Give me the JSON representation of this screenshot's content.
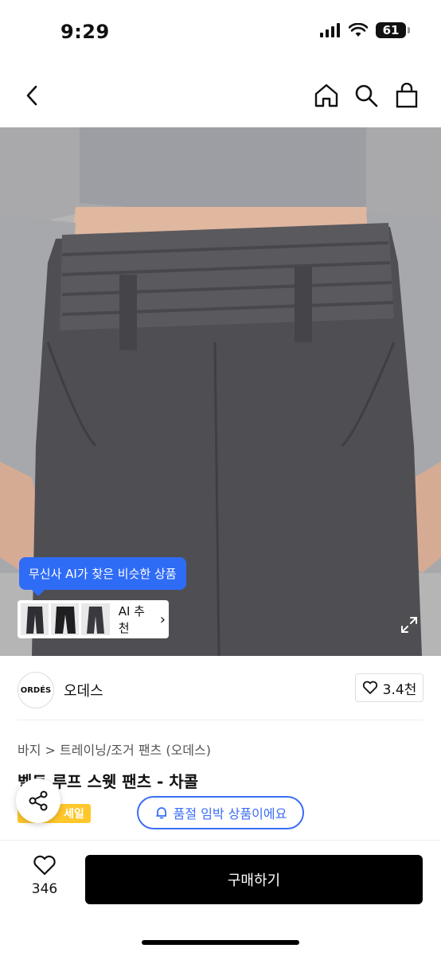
{
  "status_bar": {
    "time": "9:29",
    "battery": "61"
  },
  "nav": {
    "back_icon": "chevron-left-icon",
    "home_icon": "home-icon",
    "search_icon": "search-icon",
    "cart_icon": "bag-icon"
  },
  "ai": {
    "bubble_text": "무신사 AI가 찾은 비슷한 상품",
    "recommend_label": "AI 추천",
    "chevron": "›"
  },
  "brand": {
    "logo_text": "ORDÉS",
    "name": "오데스",
    "likes": "3.4천"
  },
  "product": {
    "breadcrumb": "바지 > 트레이닝/조거 팬츠 (오데스)",
    "title": "벨트 루프 스웻 팬츠 - 차콜",
    "sale_tag": "세일",
    "stock_notice": "품절 임박 상품이에요"
  },
  "bottom": {
    "like_count": "346",
    "buy_label": "구매하기"
  },
  "colors": {
    "accent_blue": "#2f6cf6",
    "sale_yellow": "#ffc72c",
    "buy_black": "#000000"
  }
}
